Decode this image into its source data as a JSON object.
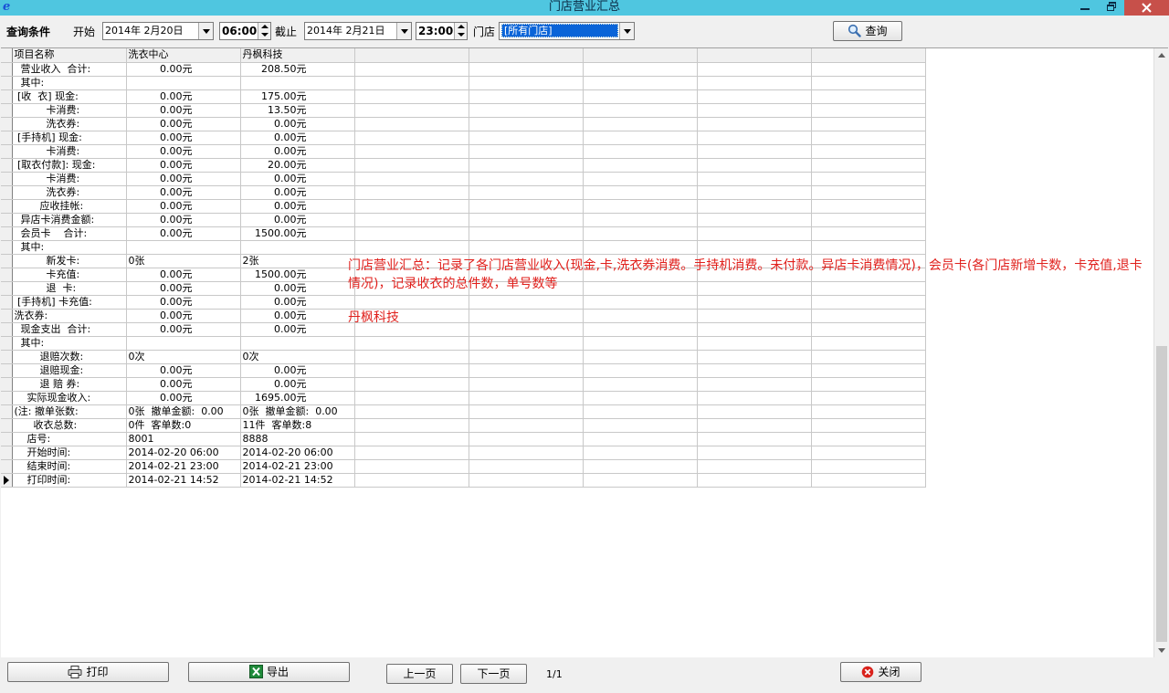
{
  "window": {
    "title": "门店营业汇总",
    "app_icon": "e"
  },
  "toolbar": {
    "query_label": "查询条件",
    "start_label": "开始",
    "start_date": "2014年 2月20日",
    "start_time": "06:00",
    "until_label": "截止",
    "end_date": "2014年 2月21日",
    "end_time": "23:00",
    "store_label": "门店",
    "store_value": "[所有门店]",
    "search_label": "查询"
  },
  "grid": {
    "headers": [
      "项目名称",
      "洗衣中心",
      "丹枫科技",
      "",
      "",
      "",
      "",
      ""
    ],
    "rows": [
      [
        "  营业收入  合计:",
        "0.00元",
        "208.50元"
      ],
      [
        "  其中:",
        "",
        ""
      ],
      [
        " [收  衣] 现金:",
        "0.00元",
        "175.00元"
      ],
      [
        "          卡消费:",
        "0.00元",
        "13.50元"
      ],
      [
        "          洗衣券:",
        "0.00元",
        "0.00元"
      ],
      [
        " [手持机] 现金:",
        "0.00元",
        "0.00元"
      ],
      [
        "          卡消费:",
        "0.00元",
        "0.00元"
      ],
      [
        " [取衣付款]: 现金:",
        "0.00元",
        "20.00元"
      ],
      [
        "          卡消费:",
        "0.00元",
        "0.00元"
      ],
      [
        "          洗衣券:",
        "0.00元",
        "0.00元"
      ],
      [
        "        应收挂帐:",
        "0.00元",
        "0.00元"
      ],
      [
        "  异店卡消费金额:",
        "0.00元",
        "0.00元"
      ],
      [
        "  会员卡    合计:",
        "0.00元",
        "1500.00元"
      ],
      [
        "  其中:",
        "",
        ""
      ],
      [
        "          新发卡:",
        "0张",
        "2张"
      ],
      [
        "          卡充值:",
        "0.00元",
        "1500.00元"
      ],
      [
        "          退  卡:",
        "0.00元",
        "0.00元"
      ],
      [
        " [手持机] 卡充值:",
        "0.00元",
        "0.00元"
      ],
      [
        "洗衣券:",
        "0.00元",
        "0.00元"
      ],
      [
        "  现金支出  合计:",
        "0.00元",
        "0.00元"
      ],
      [
        "  其中:",
        "",
        ""
      ],
      [
        "        退赔次数:",
        "0次",
        "0次"
      ],
      [
        "        退赔现金:",
        "0.00元",
        "0.00元"
      ],
      [
        "        退 赔 券:",
        "0.00元",
        "0.00元"
      ],
      [
        "    实际现金收入:",
        "0.00元",
        "1695.00元"
      ],
      [
        "(注: 撤单张数:",
        "0张  撤单金额:  0.00",
        "0张  撤单金额:  0.00"
      ],
      [
        "      收衣总数:",
        "0件  客单数:0",
        "11件  客单数:8"
      ],
      [
        "    店号:",
        "8001",
        "8888"
      ],
      [
        "    开始时间:",
        "2014-02-20 06:00",
        "2014-02-20 06:00"
      ],
      [
        "    结束时间:",
        "2014-02-21 23:00",
        "2014-02-21 23:00"
      ],
      [
        "    打印时间:",
        "2014-02-21 14:52",
        "2014-02-21 14:52"
      ]
    ],
    "numeric_rows": [
      0,
      2,
      3,
      4,
      5,
      6,
      7,
      8,
      9,
      10,
      11,
      12,
      15,
      16,
      17,
      18,
      19,
      22,
      23,
      24
    ],
    "current_row": 30
  },
  "annotation": {
    "text": "门店营业汇总：记录了各门店营业收入(现金,卡,洗衣券消费。手持机消费。未付款。异店卡消费情况)，会员卡(各门店新增卡数，卡充值,退卡情况)，记录收衣的总件数，单号数等",
    "brand": "丹枫科技"
  },
  "bottom": {
    "print_label": "打印",
    "export_label": "导出",
    "prev_label": "上一页",
    "next_label": "下一页",
    "page": "1/1",
    "close_label": "关闭"
  },
  "colors": {
    "titlebar": "#4fc6e0",
    "annotation": "#e0201c",
    "selection": "#0a64d8",
    "close": "#c7504a"
  }
}
